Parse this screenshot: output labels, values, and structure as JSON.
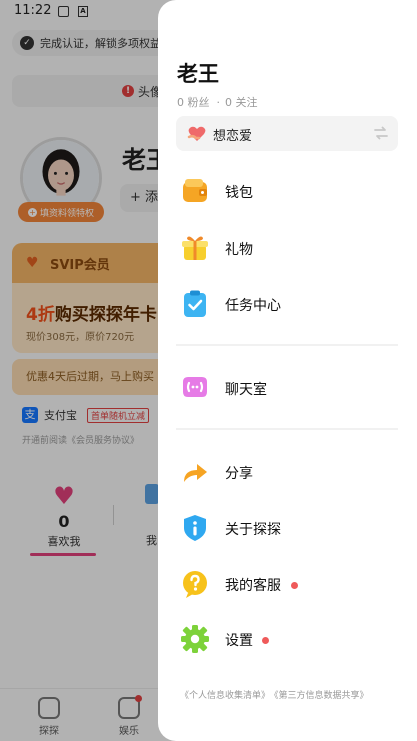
{
  "status_bar": {
    "time": "11:22"
  },
  "background": {
    "verify_text": "完成认证，解锁多项权益",
    "warn_text": "头像",
    "profile_name": "老王",
    "add_label": "添",
    "fill_badge": "填资料领特权",
    "svip_title": "SVIP会员",
    "svip_offer_highlight": "4折",
    "svip_offer_rest": "购买探探年卡",
    "svip_price": "现价308元，原价720元",
    "svip_notice": "优惠4天后过期，马上购买",
    "alipay_label": "支付宝",
    "alipay_tag": "首单随机立减",
    "alipay_agree": "开通前阅读《会员服务协议》",
    "like_count": "0",
    "like_label": "喜欢我",
    "my_label": "我",
    "nav": [
      {
        "label": "探探"
      },
      {
        "label": "娱乐"
      }
    ]
  },
  "drawer": {
    "name": "老王",
    "fans": "0 粉丝",
    "following": "0 关注",
    "separator": "·",
    "mood": "想恋爱",
    "menu": [
      {
        "label": "钱包",
        "icon": "wallet-icon"
      },
      {
        "label": "礼物",
        "icon": "gift-icon"
      },
      {
        "label": "任务中心",
        "icon": "task-center-icon"
      },
      {
        "label": "聊天室",
        "icon": "chat-room-icon"
      },
      {
        "label": "分享",
        "icon": "share-icon"
      },
      {
        "label": "关于探探",
        "icon": "info-icon"
      },
      {
        "label": "我的客服",
        "icon": "customer-service-icon",
        "dot": true
      },
      {
        "label": "设置",
        "icon": "gear-icon",
        "dot": true
      }
    ],
    "footer": {
      "info_list": "《个人信息收集清单》",
      "third_party": "《第三方信息数据共享》"
    }
  },
  "colors": {
    "accent_pink": "#e0407a",
    "dot_red": "#ef5a5a",
    "svip_orange": "#f04f1a"
  }
}
